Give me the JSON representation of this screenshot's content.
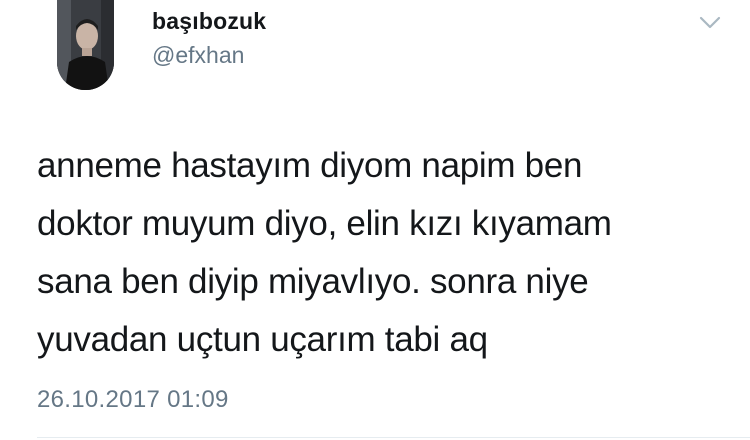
{
  "author": {
    "name": "başıbozuk",
    "handle": "@efxhan"
  },
  "icons": {
    "menu": "chevron-down-icon"
  },
  "tweet": {
    "lines": [
      "anneme hastayım diyom napim ben",
      "doktor muyum diyo, elin kızı kıyamam",
      "sana ben diyip miyavlıyo. sonra niye",
      "yuvadan uçtun uçarım tabi aq"
    ],
    "timestamp": "26.10.2017 01:09"
  },
  "colors": {
    "text": "#14171a",
    "secondary": "#657786",
    "divider": "#e6ecf0"
  }
}
